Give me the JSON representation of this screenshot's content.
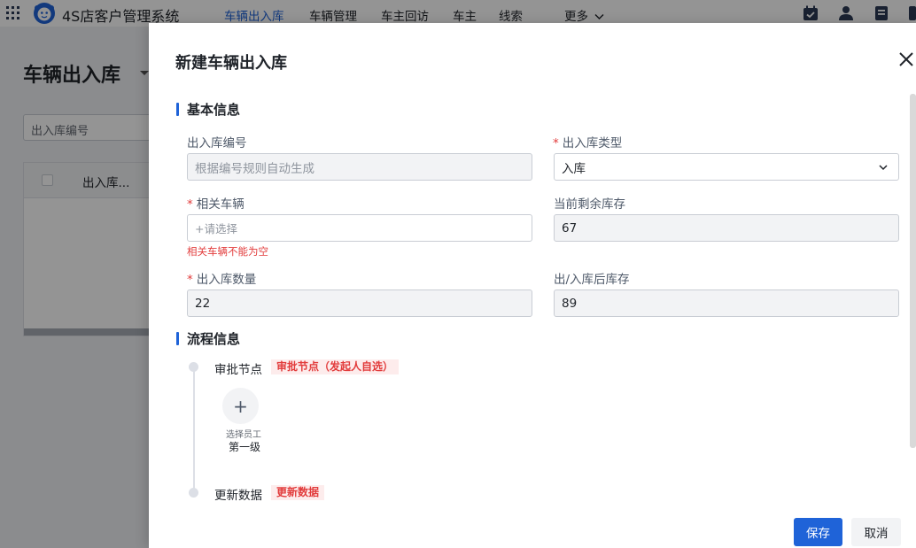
{
  "app": {
    "title": "4S店客户管理系统"
  },
  "nav": {
    "items": [
      "车辆出入库",
      "车辆管理",
      "车主回访",
      "车主",
      "线索"
    ],
    "more": "更多"
  },
  "background": {
    "page_title": "车辆出入库",
    "search_placeholder": "出入库编号",
    "table_header": "出入库..."
  },
  "drawer": {
    "title": "新建车辆出入库",
    "sections": {
      "basic": "基本信息",
      "process": "流程信息"
    },
    "fields": {
      "record_no": {
        "label": "出入库编号",
        "placeholder": "根据编号规则自动生成"
      },
      "type": {
        "label": "出入库类型",
        "value": "入库"
      },
      "vehicle": {
        "label": "相关车辆",
        "placeholder": "+请选择",
        "error": "相关车辆不能为空"
      },
      "stock": {
        "label": "当前剩余库存",
        "value": "67"
      },
      "quantity": {
        "label": "出入库数量",
        "value": "22"
      },
      "after_stock": {
        "label": "出/入库后库存",
        "value": "89"
      }
    },
    "required_mark": "*",
    "flow": {
      "approval": {
        "title": "审批节点",
        "tag": "审批节点（发起人自选）",
        "add_label": "选择员工",
        "level": "第一级",
        "add_symbol": "+"
      },
      "update": {
        "title": "更新数据",
        "tag": "更新数据"
      }
    },
    "buttons": {
      "save": "保存",
      "cancel": "取消"
    }
  },
  "colors": {
    "primary": "#1f63d8",
    "danger": "#e23c3c",
    "tag_bg": "#fdecec"
  }
}
